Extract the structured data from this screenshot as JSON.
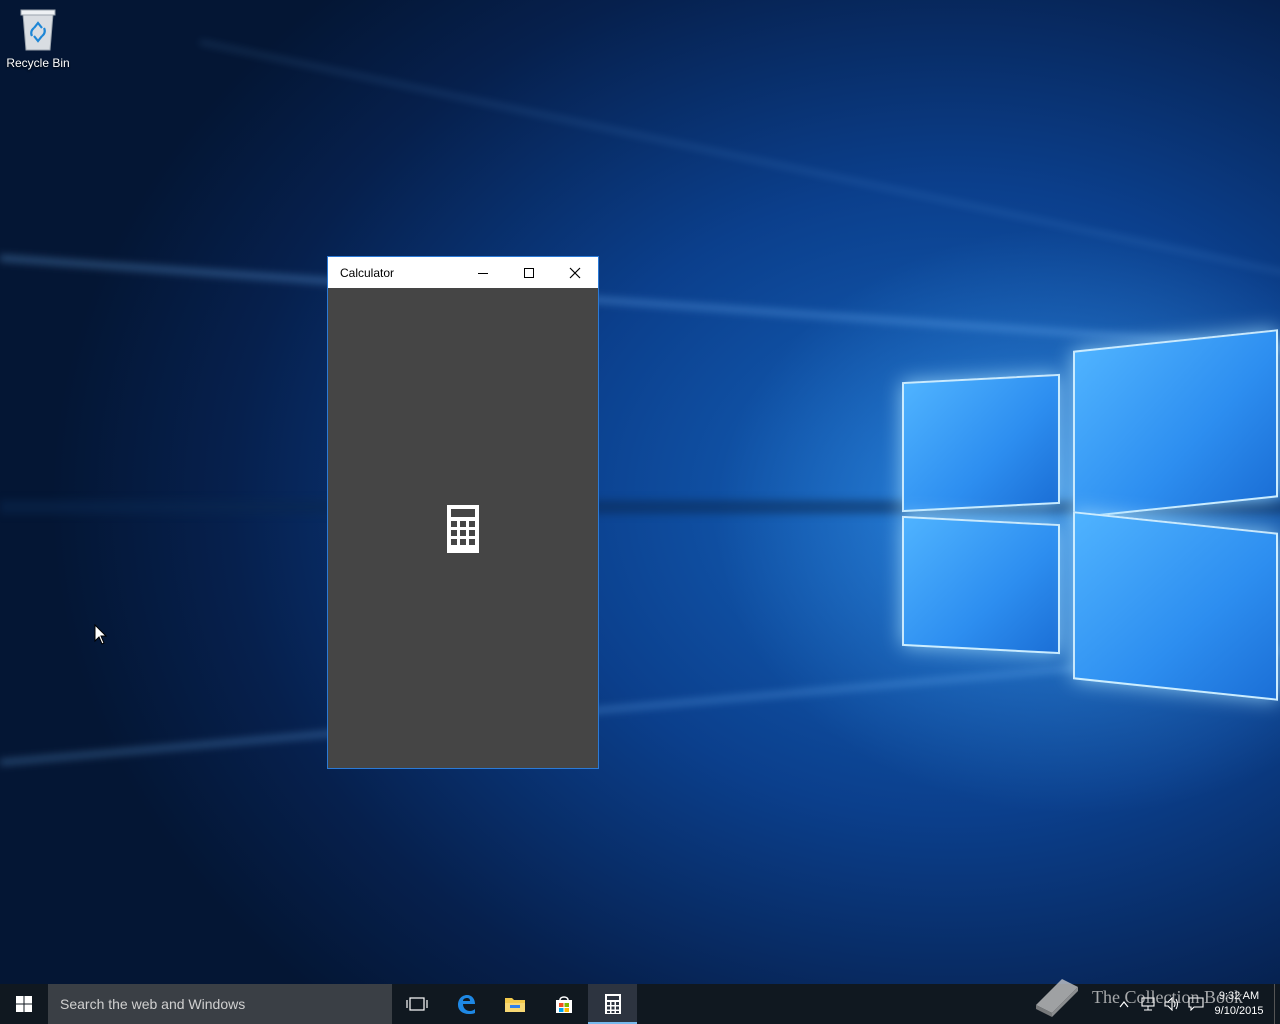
{
  "desktop": {
    "icons": [
      {
        "label": "Recycle Bin"
      }
    ]
  },
  "calculator_window": {
    "title": "Calculator",
    "controls": {
      "minimize": "minimize",
      "maximize": "maximize",
      "close": "close"
    },
    "splash_icon": "calculator-icon",
    "background_color": "#454545"
  },
  "taskbar": {
    "search_placeholder": "Search the web and Windows",
    "pinned": [
      {
        "name": "task-view-icon"
      },
      {
        "name": "edge-icon"
      },
      {
        "name": "file-explorer-icon"
      },
      {
        "name": "store-icon"
      },
      {
        "name": "calculator-icon",
        "active": true
      }
    ],
    "clock": {
      "time": "9:32 AM",
      "date": "9/10/2015"
    }
  },
  "watermark": {
    "text": "The Collection Book"
  }
}
